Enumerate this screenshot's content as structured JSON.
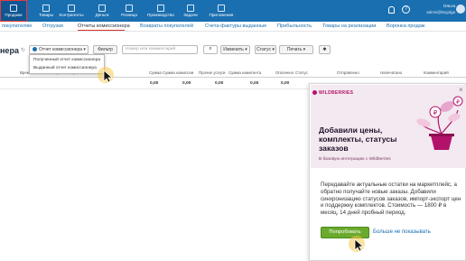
{
  "nav": {
    "items": [
      {
        "label": "Продажи",
        "icon": "shopping-bag-icon"
      },
      {
        "label": "Товары",
        "icon": "box-icon"
      },
      {
        "label": "Контрагенты",
        "icon": "people-icon"
      },
      {
        "label": "Деньги",
        "icon": "money-icon"
      },
      {
        "label": "Розница",
        "icon": "cart-icon"
      },
      {
        "label": "Производство",
        "icon": "factory-icon"
      },
      {
        "label": "Задачи",
        "icon": "tasks-icon"
      },
      {
        "label": "Приложения",
        "icon": "apps-icon"
      }
    ],
    "help_glyph": "?",
    "user_name": "Ольга",
    "user_email": "admin@kngolga"
  },
  "tabs": [
    {
      "label": "покупателям"
    },
    {
      "label": "Отгрузки"
    },
    {
      "label": "Отчеты комиссионера"
    },
    {
      "label": "Возвраты покупателей"
    },
    {
      "label": "Счета-фактуры выданные"
    },
    {
      "label": "Прибыльность"
    },
    {
      "label": "Товары на реализации"
    },
    {
      "label": "Воронка продаж"
    }
  ],
  "toolbar": {
    "title": "нера",
    "refresh_glyph": "↻",
    "report_type_value": "Отчет комиссионера ▾",
    "filter_label": "Фильтр",
    "search_placeholder": "Номер или комментарий",
    "counter_value": "0",
    "edit_label": "Изменить ▾",
    "status_label": "Статус ▾",
    "print_label": "Печать ▾",
    "settings_glyph": "✱"
  },
  "dropdown": {
    "options": [
      "Полученный отчет комиссионера",
      "Выданный отчет комиссионера"
    ]
  },
  "table": {
    "headers": [
      "Время",
      "Организация",
      "Сумма",
      "Сумма комиссии",
      "Прочие услуги",
      "Сумма комитента",
      "Оплачено",
      "Статус",
      "Отправлено",
      "Напечатано",
      "Комментарий"
    ],
    "totals": [
      "0,00",
      "0,00",
      "0,00",
      "0,00",
      "0,00"
    ]
  },
  "promo": {
    "brand": "WILDBERRIES",
    "close_glyph": "×",
    "heading": "Добавили цены, комплекты, статусы заказов",
    "subheading": "В базовую интеграцию с Wildberries",
    "body": "Передавайте актуальные остатки на маркетплейс, а обратно получайте новые заказы. Добавили синхронизацию статусов заказов, импорт-экспорт цен и поддержку комплектов. Стоимость — 1800 ₽ в месяц, 14 дней пробный период.",
    "try_label": "Попробовать",
    "dismiss_label": "Больше не показывать",
    "colors": {
      "brand": "#b3126b",
      "button": "#6aab2e",
      "panel_bg": "#f3e9f0"
    }
  },
  "colors": {
    "nav_bg": "#1a6fb0",
    "active_nav_outline": "#e23b3b",
    "link": "#1a6fb0"
  }
}
